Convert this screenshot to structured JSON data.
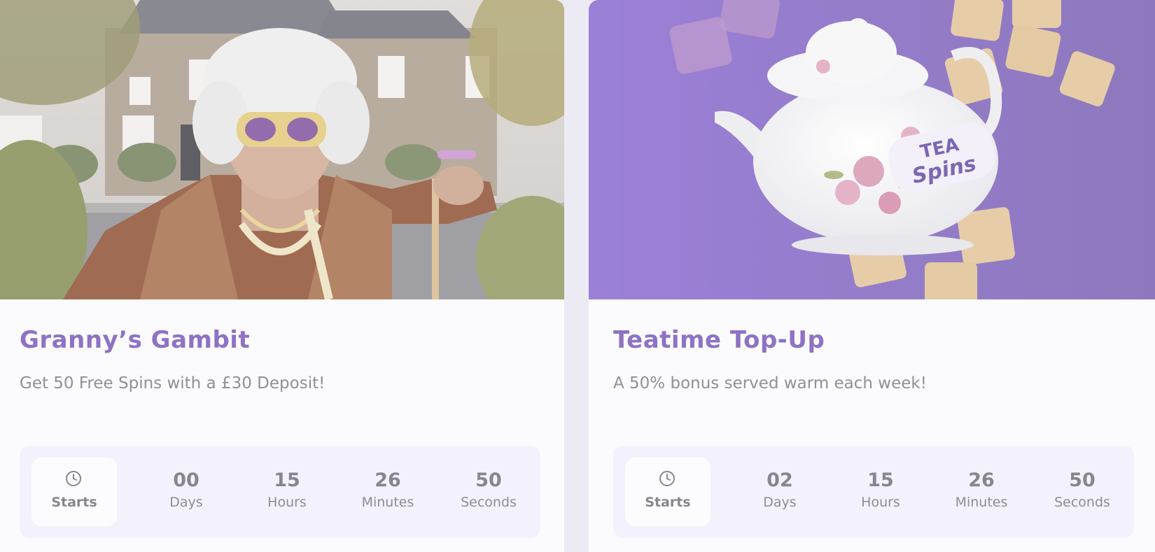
{
  "promotions": [
    {
      "title": "Granny’s Gambit",
      "description": "Get 50 Free Spins with a £30 Deposit!",
      "countdown": {
        "starts_label": "Starts",
        "days": "00",
        "days_label": "Days",
        "hours": "15",
        "hours_label": "Hours",
        "minutes": "26",
        "minutes_label": "Minutes",
        "seconds": "50",
        "seconds_label": "Seconds"
      }
    },
    {
      "title": "Teatime Top-Up",
      "description": "A 50% bonus served warm each week!",
      "banner_logo": "TEA Spins",
      "countdown": {
        "starts_label": "Starts",
        "days": "02",
        "days_label": "Days",
        "hours": "15",
        "hours_label": "Hours",
        "minutes": "26",
        "minutes_label": "Minutes",
        "seconds": "50",
        "seconds_label": "Seconds"
      }
    }
  ],
  "colors": {
    "title": "#8e72c4",
    "text": "#8f8f95",
    "countdown_bg": "#f3f1fb",
    "banner_purple": "#8a6cc8"
  },
  "icons": [
    "clock-icon"
  ]
}
